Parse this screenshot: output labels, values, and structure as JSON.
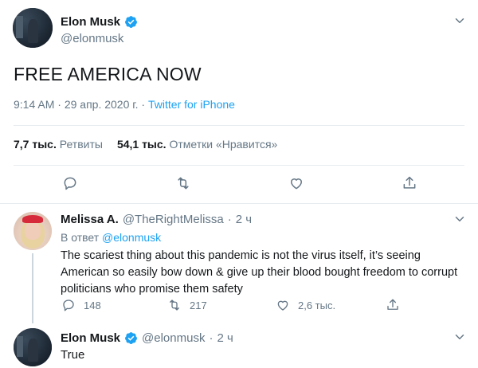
{
  "main_tweet": {
    "author_name": "Elon Musk",
    "author_handle": "@elonmusk",
    "text": "FREE AMERICA NOW",
    "time": "9:14 AM",
    "date": "29 апр. 2020 г.",
    "source": "Twitter for iPhone",
    "meta_separator": " · ",
    "retweets_count": "7,7 тыс.",
    "retweets_label": "Ретвиты",
    "likes_count": "54,1 тыс.",
    "likes_label": "Отметки «Нравится»"
  },
  "reply": {
    "author_name": "Melissa A.",
    "author_handle": "@TheRightMelissa",
    "age": "2 ч",
    "in_reply_prefix": "В ответ",
    "in_reply_handle": "@elonmusk",
    "text": "The scariest thing about this pandemic is not the virus itself, it’s seeing American so easily bow down & give up their blood bought freedom to corrupt politicians who promise them safety",
    "reply_count": "148",
    "retweet_count": "217",
    "like_count": "2,6 тыс."
  },
  "last_reply": {
    "author_name": "Elon Musk",
    "author_handle": "@elonmusk",
    "age": "2 ч",
    "text": "True"
  },
  "colors": {
    "accent": "#1da1f2",
    "muted": "#657786",
    "text": "#14171a",
    "divider": "#e6ecf0"
  },
  "icons": [
    "verified-badge-icon",
    "chevron-down-icon",
    "reply-icon",
    "retweet-icon",
    "like-icon",
    "share-icon"
  ]
}
